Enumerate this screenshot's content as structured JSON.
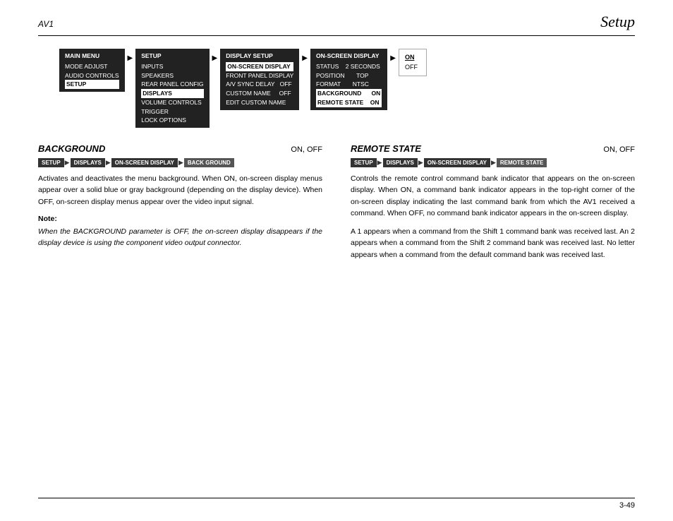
{
  "header": {
    "left": "AV1",
    "right": "Setup"
  },
  "menu_diagram": {
    "boxes": [
      {
        "id": "main-menu",
        "title": "MAIN MENU",
        "items": [
          "MODE ADJUST",
          "AUDIO CONTROLS",
          "SETUP"
        ],
        "highlighted": [
          "SETUP"
        ]
      },
      {
        "id": "setup",
        "title": "SETUP",
        "items": [
          "INPUTS",
          "SPEAKERS",
          "REAR PANEL CONFIG",
          "DISPLAYS",
          "VOLUME CONTROLS",
          "TRIGGER",
          "LOCK OPTIONS"
        ],
        "highlighted": [
          "DISPLAYS"
        ]
      },
      {
        "id": "display-setup",
        "title": "DISPLAY SETUP",
        "items": [
          "ON-SCREEN DISPLAY",
          "FRONT PANEL DISPLAY",
          "A/V SYNC DELAY   OFF",
          "CUSTOM NAME      OFF",
          "EDIT CUSTOM NAME"
        ],
        "highlighted": [
          "ON-SCREEN DISPLAY"
        ]
      },
      {
        "id": "on-screen-display",
        "title": "ON-SCREEN DISPLAY",
        "items": [
          "STATUS    2 SECONDS",
          "POSITION       TOP",
          "FORMAT        NTSC",
          "BACKGROUND      ON",
          "REMOTE STATE    ON"
        ],
        "highlighted": [
          "BACKGROUND",
          "REMOTE STATE"
        ]
      }
    ],
    "onoff": {
      "on": "ON",
      "off": "OFF"
    }
  },
  "background_section": {
    "title": "BACKGROUND",
    "options": "ON, OFF",
    "breadcrumb": [
      "SETUP",
      "DISPLAYS",
      "ON-SCREEN DISPLAY",
      "BACK GROUND"
    ],
    "body": "Activates and deactivates the menu background. When ON, on-screen display menus appear over a solid blue or gray background (depending on the display device). When OFF, on-screen display menus appear over the video input signal.",
    "note_heading": "Note:",
    "note_text": "When the BACKGROUND parameter is OFF, the on-screen display disappears if the display device is using the component video output connector."
  },
  "remote_state_section": {
    "title": "REMOTE STATE",
    "options": "ON, OFF",
    "breadcrumb": [
      "SETUP",
      "DISPLAYS",
      "ON-SCREEN DISPLAY",
      "REMOTE STATE"
    ],
    "body1": "Controls the remote control command bank indicator that appears on the on-screen display. When ON, a command bank indicator appears in the top-right corner of the on-screen display indicating the last command bank from which the AV1 received a command. When OFF, no command bank indicator appears in the on-screen display.",
    "body2": "A 1 appears when a command from the Shift 1 command bank was received last. An 2 appears when a command from the Shift 2 command bank was received last. No letter appears when a command from the default command bank was received last."
  },
  "footer": {
    "page_number": "3-49"
  }
}
